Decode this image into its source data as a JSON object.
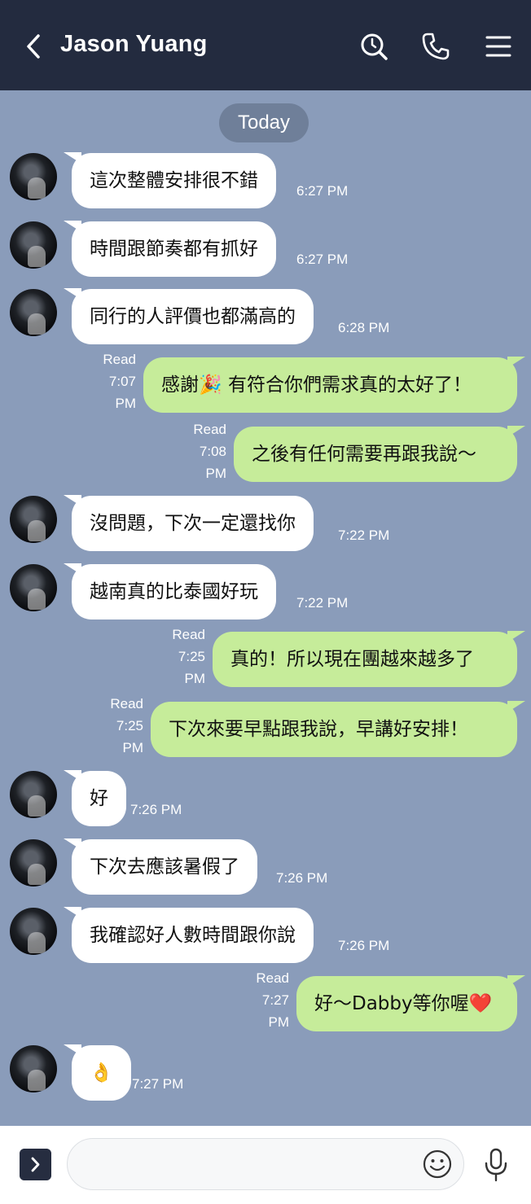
{
  "header": {
    "title": "Jason Yuang",
    "icons": [
      "back-chevron-icon",
      "search-icon",
      "phone-icon",
      "menu-icon"
    ]
  },
  "chat": {
    "date_label": "Today",
    "messages": [
      {
        "from": "other",
        "text": "這次整體安排很不錯",
        "time": "6:27 PM"
      },
      {
        "from": "other",
        "text": "時間跟節奏都有抓好",
        "time": "6:27 PM"
      },
      {
        "from": "other",
        "text": "同行的人評價也都滿高的",
        "time": "6:28 PM"
      },
      {
        "from": "me",
        "text": "感謝🎉 有符合你們需求真的太好了！",
        "read": "Read",
        "time_a": "7:07",
        "time_b": "PM"
      },
      {
        "from": "me",
        "text": "之後有任何需要再跟我說～",
        "read": "Read",
        "time_a": "7:08",
        "time_b": "PM"
      },
      {
        "from": "other",
        "text": "沒問題，下次一定還找你",
        "time": "7:22 PM"
      },
      {
        "from": "other",
        "text": "越南真的比泰國好玩",
        "time": "7:22 PM"
      },
      {
        "from": "me",
        "text": "真的！所以現在團越來越多了",
        "read": "Read",
        "time_a": "7:25",
        "time_b": "PM"
      },
      {
        "from": "me",
        "text": "下次來要早點跟我說，早講好安排！",
        "read": "Read",
        "time_a": "7:25",
        "time_b": "PM"
      },
      {
        "from": "other",
        "text": "好",
        "time": "7:26 PM"
      },
      {
        "from": "other",
        "text": "下次去應該暑假了",
        "time": "7:26 PM"
      },
      {
        "from": "other",
        "text": "我確認好人數時間跟你說",
        "time": "7:26 PM"
      },
      {
        "from": "me",
        "text": "好～Dabby等你喔❤️",
        "read": "Read",
        "time_a": "7:27",
        "time_b": "PM"
      },
      {
        "from": "other",
        "text": "👌",
        "time": "7:27 PM"
      }
    ]
  },
  "footer": {
    "input_value": "",
    "icons": [
      "expand-icon",
      "emoji-icon",
      "microphone-icon"
    ]
  },
  "colors": {
    "header_bg": "#232b3f",
    "chat_bg": "#8a9cba",
    "sent_bubble": "#c6ec9a",
    "received_bubble": "#ffffff"
  }
}
